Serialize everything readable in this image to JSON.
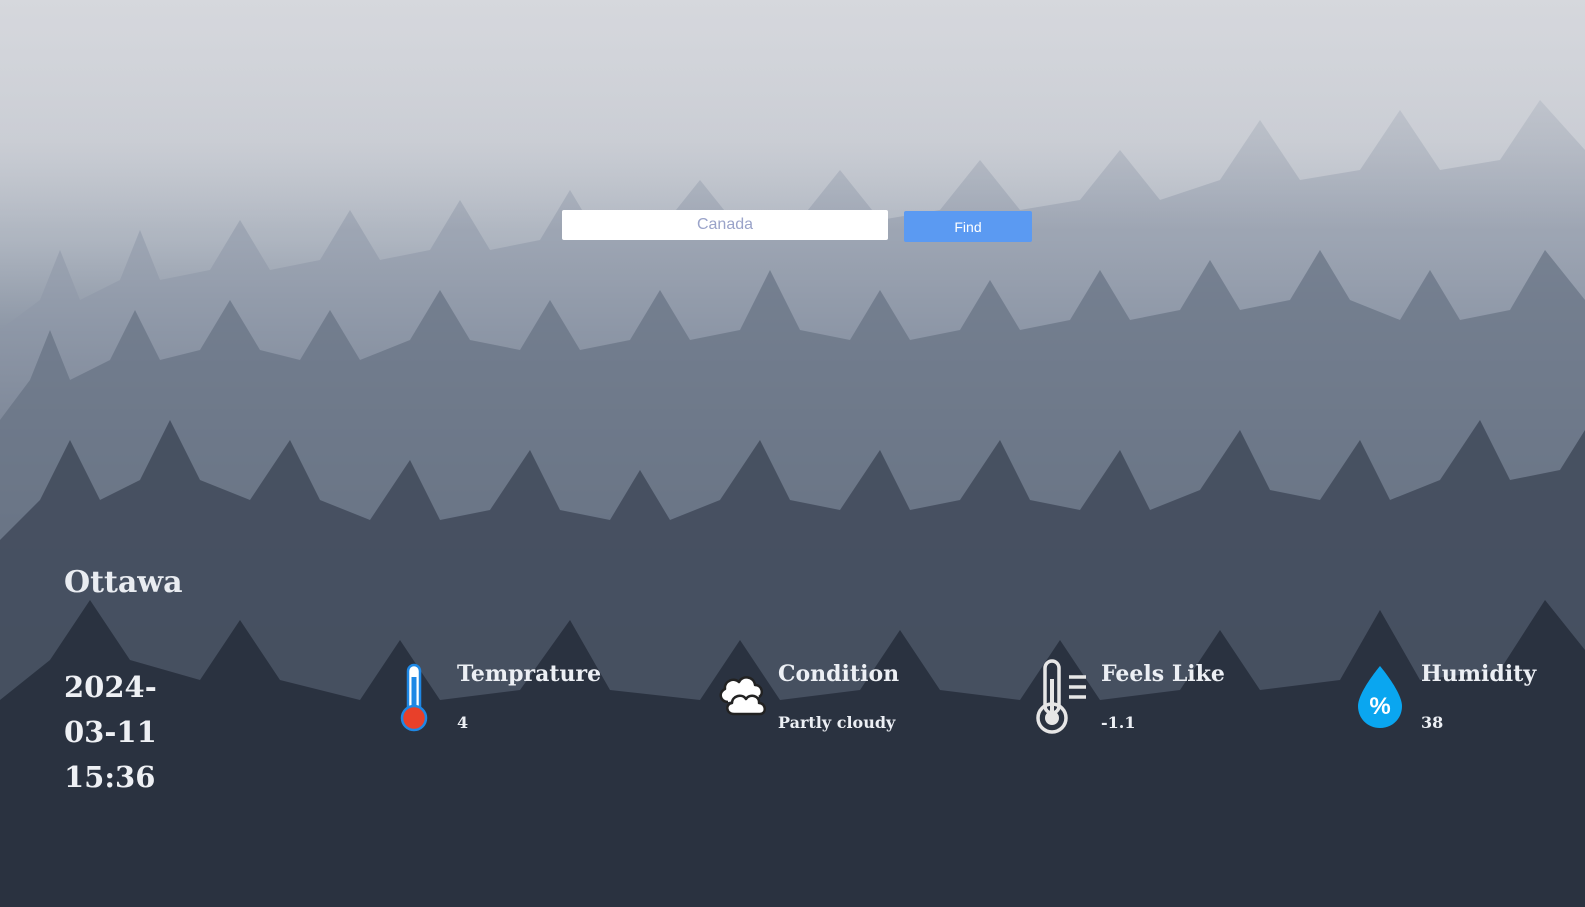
{
  "search": {
    "placeholder": "Canada",
    "button_label": "Find"
  },
  "location": {
    "city": "Ottawa",
    "date_line1": "2024-",
    "date_line2": "03-11",
    "time": "15:36"
  },
  "stats": {
    "temperature": {
      "label": "Temprature",
      "value": "4",
      "icon": "thermometer-icon"
    },
    "condition": {
      "label": "Condition",
      "value": "Partly cloudy",
      "icon": "cloud-icon"
    },
    "feels_like": {
      "label": "Feels Like",
      "value": "-1.1",
      "icon": "thermometer-gauge-icon"
    },
    "humidity": {
      "label": "Humidity",
      "value": "38",
      "icon": "humidity-drop-icon"
    }
  },
  "colors": {
    "find_button": "#5b9af2",
    "thermometer_red": "#e8402a",
    "thermometer_blue": "#1e88e5",
    "humidity_blue": "#0aa6f0"
  }
}
